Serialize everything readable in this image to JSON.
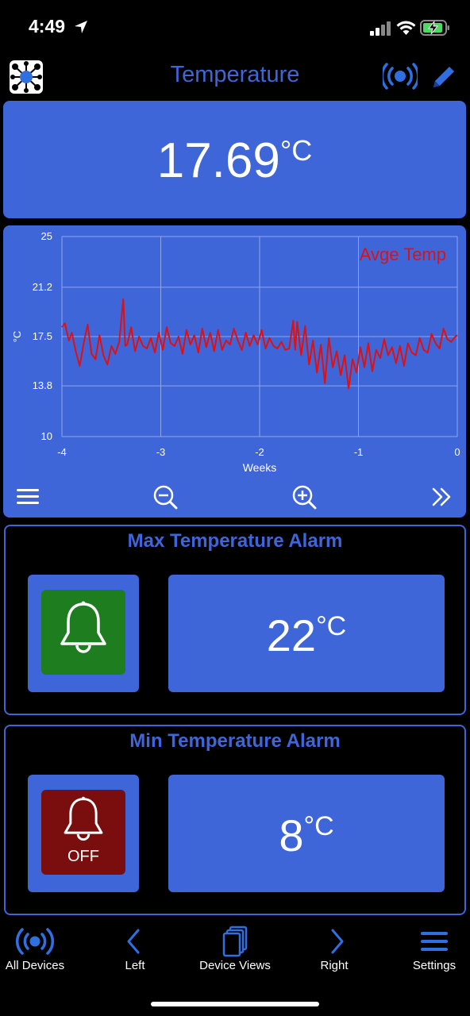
{
  "status_bar": {
    "time": "4:49"
  },
  "header": {
    "title": "Temperature",
    "logo_icon": "network-hub-icon",
    "broadcast_icon": "broadcast-icon",
    "edit_icon": "pencil-icon"
  },
  "reading": {
    "value": "17.69",
    "unit": "°C"
  },
  "chart_data": {
    "type": "line",
    "title": "",
    "legend": "Avge Temp",
    "xlabel": "Weeks",
    "ylabel": "°C",
    "xlim": [
      -4,
      0
    ],
    "ylim": [
      10,
      25
    ],
    "x_ticks": [
      "-4",
      "-3",
      "-2",
      "-1",
      "0"
    ],
    "y_ticks": [
      "25",
      "21.2",
      "17.5",
      "13.8",
      "10"
    ],
    "grid": true,
    "series": [
      {
        "name": "Avge Temp",
        "color": "#e01010",
        "x": [
          -4.0,
          -3.97,
          -3.93,
          -3.9,
          -3.86,
          -3.82,
          -3.78,
          -3.74,
          -3.7,
          -3.66,
          -3.62,
          -3.58,
          -3.54,
          -3.5,
          -3.46,
          -3.42,
          -3.38,
          -3.36,
          -3.34,
          -3.3,
          -3.26,
          -3.22,
          -3.18,
          -3.14,
          -3.1,
          -3.06,
          -3.02,
          -2.98,
          -2.94,
          -2.9,
          -2.86,
          -2.82,
          -2.78,
          -2.74,
          -2.7,
          -2.66,
          -2.62,
          -2.58,
          -2.54,
          -2.5,
          -2.46,
          -2.42,
          -2.38,
          -2.34,
          -2.3,
          -2.26,
          -2.22,
          -2.18,
          -2.14,
          -2.1,
          -2.06,
          -2.02,
          -1.98,
          -1.94,
          -1.9,
          -1.86,
          -1.82,
          -1.78,
          -1.74,
          -1.7,
          -1.66,
          -1.64,
          -1.62,
          -1.58,
          -1.54,
          -1.5,
          -1.46,
          -1.42,
          -1.38,
          -1.34,
          -1.3,
          -1.26,
          -1.22,
          -1.18,
          -1.14,
          -1.1,
          -1.06,
          -1.02,
          -0.98,
          -0.94,
          -0.9,
          -0.86,
          -0.82,
          -0.78,
          -0.74,
          -0.7,
          -0.66,
          -0.62,
          -0.58,
          -0.54,
          -0.5,
          -0.46,
          -0.42,
          -0.38,
          -0.34,
          -0.3,
          -0.26,
          -0.22,
          -0.18,
          -0.14,
          -0.1,
          -0.06,
          -0.02,
          0.0
        ],
        "y": [
          18.2,
          18.5,
          17.2,
          17.8,
          16.4,
          15.3,
          17.0,
          18.4,
          16.2,
          15.8,
          17.6,
          16.1,
          15.4,
          16.8,
          16.2,
          17.1,
          20.3,
          16.8,
          16.9,
          18.2,
          16.4,
          17.5,
          16.8,
          16.6,
          17.4,
          16.3,
          17.8,
          16.5,
          18.2,
          17.0,
          16.8,
          17.5,
          16.2,
          18.0,
          16.9,
          17.6,
          16.3,
          18.1,
          16.7,
          17.8,
          16.4,
          18.0,
          16.5,
          17.2,
          16.9,
          18.1,
          17.2,
          16.5,
          17.8,
          16.8,
          17.6,
          16.9,
          18.0,
          16.6,
          17.4,
          16.8,
          16.6,
          17.1,
          16.5,
          16.6,
          18.7,
          16.5,
          18.6,
          16.1,
          18.3,
          15.4,
          17.2,
          14.8,
          16.9,
          14.0,
          17.4,
          15.2,
          16.4,
          14.6,
          16.1,
          13.6,
          15.8,
          14.8,
          16.7,
          15.2,
          17.0,
          14.9,
          16.5,
          15.9,
          17.3,
          16.1,
          16.7,
          15.5,
          16.8,
          15.3,
          17.0,
          16.3,
          16.1,
          17.4,
          16.5,
          16.3,
          17.7,
          17.0,
          16.6,
          18.1,
          17.3,
          17.1,
          17.5,
          17.6
        ]
      }
    ]
  },
  "chart_toolbar": {
    "menu_icon": "hamburger-menu-icon",
    "zoom_out_icon": "zoom-out-icon",
    "zoom_in_icon": "zoom-in-icon",
    "next_icon": "double-chevron-right-icon"
  },
  "max_alarm": {
    "title": "Max Temperature Alarm",
    "state": "on",
    "state_color": "#1e7d1e",
    "value": "22",
    "unit": "°C"
  },
  "min_alarm": {
    "title": "Min Temperature Alarm",
    "state_label": "OFF",
    "state_color": "#7a0e0e",
    "value": "8",
    "unit": "°C"
  },
  "nav": {
    "all_devices": "All Devices",
    "left": "Left",
    "device_views": "Device Views",
    "right": "Right",
    "settings": "Settings"
  },
  "colors": {
    "accent": "#3f66d8",
    "background": "#000000",
    "line": "#e01010"
  }
}
